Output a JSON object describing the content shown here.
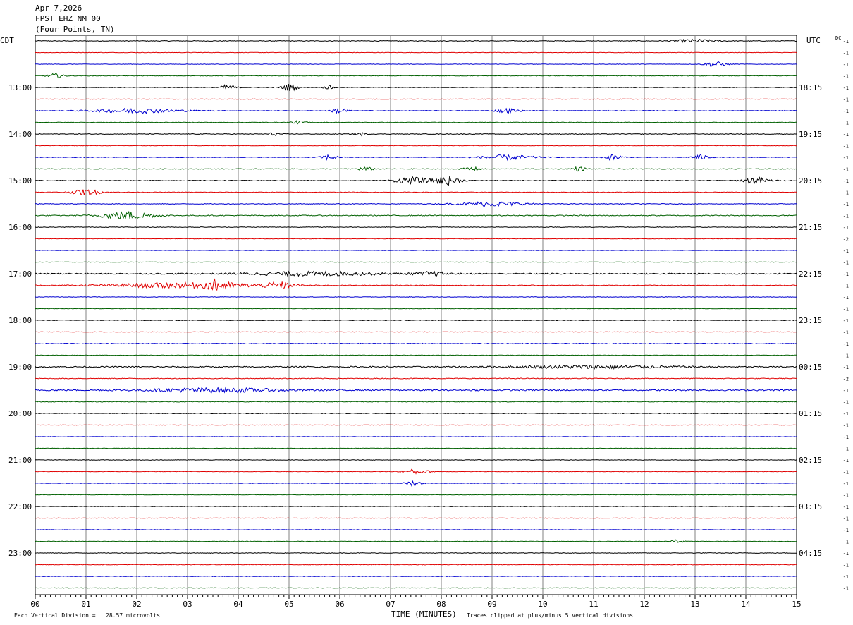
{
  "header": {
    "date": "Apr 7,2026",
    "station": "FPST EHZ NM 00",
    "location": "(Four Points, TN)"
  },
  "labels": {
    "left_tz": "CDT",
    "right_tz": "UTC",
    "dc": "DC"
  },
  "footer": {
    "scale": "Each Vertical Division =   28.57 microvolts",
    "xlabel": "TIME (MINUTES)",
    "clip": "Traces clipped at plus/minus 5 vertical divisions"
  },
  "colors": {
    "cycle": [
      "#000000",
      "#e00000",
      "#0000d0",
      "#006000"
    ],
    "grid": "#808080"
  },
  "chart_data": {
    "type": "line",
    "title": "FPST EHZ NM 00 (Four Points, TN) Apr 7,2026",
    "xlabel": "TIME (MINUTES)",
    "xlim": [
      0,
      15
    ],
    "x_ticks": [
      "00",
      "01",
      "02",
      "03",
      "04",
      "05",
      "06",
      "07",
      "08",
      "09",
      "10",
      "11",
      "12",
      "13",
      "14",
      "15"
    ],
    "rows": 48,
    "row_minutes": 15,
    "left_time_labels": [
      {
        "row": 4,
        "label": "13:00"
      },
      {
        "row": 8,
        "label": "14:00"
      },
      {
        "row": 12,
        "label": "15:00"
      },
      {
        "row": 16,
        "label": "16:00"
      },
      {
        "row": 20,
        "label": "17:00"
      },
      {
        "row": 24,
        "label": "18:00"
      },
      {
        "row": 28,
        "label": "19:00"
      },
      {
        "row": 32,
        "label": "20:00"
      },
      {
        "row": 36,
        "label": "21:00"
      },
      {
        "row": 40,
        "label": "22:00"
      },
      {
        "row": 44,
        "label": "23:00"
      }
    ],
    "right_time_labels": [
      {
        "row": 4,
        "label": "18:15"
      },
      {
        "row": 8,
        "label": "19:15"
      },
      {
        "row": 12,
        "label": "20:15"
      },
      {
        "row": 16,
        "label": "21:15"
      },
      {
        "row": 20,
        "label": "22:15"
      },
      {
        "row": 24,
        "label": "23:15"
      },
      {
        "row": 28,
        "label": "00:15"
      },
      {
        "row": 32,
        "label": "01:15"
      },
      {
        "row": 36,
        "label": "02:15"
      },
      {
        "row": 40,
        "label": "03:15"
      },
      {
        "row": 44,
        "label": "04:15"
      }
    ],
    "dc_offsets": [
      "-1",
      "-1",
      "-1",
      "-1",
      "-1",
      "-1",
      "-1",
      "-1",
      "-1",
      "-1",
      "-1",
      "-1",
      "-1",
      "-1",
      "-1",
      "-1",
      "-1",
      "-2",
      "-1",
      "-1",
      "-1",
      "-1",
      "-1",
      "-1",
      "-1",
      "-1",
      "-1",
      "-1",
      "-1",
      "-2",
      "-1",
      "-1",
      "-1",
      "-1",
      "-1",
      "-1",
      "-1",
      "-1",
      "-1",
      "-1",
      "-1",
      "-1",
      "-1",
      "-1",
      "-1",
      "-1",
      "-1",
      "-1"
    ],
    "row_noise": [
      0.9,
      0.6,
      0.6,
      0.8,
      0.8,
      0.6,
      0.9,
      0.7,
      0.9,
      0.6,
      0.9,
      0.9,
      1.0,
      0.8,
      0.9,
      1.2,
      0.8,
      0.6,
      0.6,
      0.6,
      1.6,
      0.9,
      0.7,
      0.6,
      0.9,
      0.6,
      1.0,
      0.6,
      1.5,
      1.0,
      1.8,
      0.9,
      0.9,
      0.6,
      0.6,
      0.6,
      0.7,
      0.6,
      0.6,
      0.6,
      0.7,
      0.6,
      0.7,
      0.7,
      0.8,
      0.8,
      0.8,
      0.7
    ],
    "events": [
      {
        "row": 0,
        "t": 13.0,
        "amp": 4,
        "dur": 0.8
      },
      {
        "row": 2,
        "t": 13.4,
        "amp": 7,
        "dur": 0.4
      },
      {
        "row": 3,
        "t": 0.4,
        "amp": 6,
        "dur": 0.3
      },
      {
        "row": 4,
        "t": 3.8,
        "amp": 7,
        "dur": 0.3
      },
      {
        "row": 4,
        "t": 5.0,
        "amp": 9,
        "dur": 0.3
      },
      {
        "row": 4,
        "t": 5.8,
        "amp": 5,
        "dur": 0.2
      },
      {
        "row": 6,
        "t": 2.0,
        "amp": 6,
        "dur": 1.6
      },
      {
        "row": 6,
        "t": 6.0,
        "amp": 7,
        "dur": 0.3
      },
      {
        "row": 6,
        "t": 9.3,
        "amp": 6,
        "dur": 0.4
      },
      {
        "row": 7,
        "t": 5.2,
        "amp": 4,
        "dur": 0.3
      },
      {
        "row": 8,
        "t": 4.7,
        "amp": 4,
        "dur": 0.2
      },
      {
        "row": 8,
        "t": 6.4,
        "amp": 4,
        "dur": 0.2
      },
      {
        "row": 10,
        "t": 5.8,
        "amp": 7,
        "dur": 0.3
      },
      {
        "row": 10,
        "t": 9.3,
        "amp": 6,
        "dur": 1.0
      },
      {
        "row": 10,
        "t": 11.4,
        "amp": 8,
        "dur": 0.3
      },
      {
        "row": 10,
        "t": 13.1,
        "amp": 7,
        "dur": 0.3
      },
      {
        "row": 11,
        "t": 6.5,
        "amp": 5,
        "dur": 0.3
      },
      {
        "row": 11,
        "t": 8.6,
        "amp": 5,
        "dur": 0.3
      },
      {
        "row": 11,
        "t": 10.7,
        "amp": 5,
        "dur": 0.3
      },
      {
        "row": 12,
        "t": 7.4,
        "amp": 9,
        "dur": 0.6
      },
      {
        "row": 12,
        "t": 8.1,
        "amp": 12,
        "dur": 0.5
      },
      {
        "row": 12,
        "t": 14.2,
        "amp": 8,
        "dur": 0.5
      },
      {
        "row": 13,
        "t": 1.0,
        "amp": 7,
        "dur": 0.6
      },
      {
        "row": 14,
        "t": 9.0,
        "amp": 6,
        "dur": 1.2
      },
      {
        "row": 15,
        "t": 1.8,
        "amp": 10,
        "dur": 1.0
      },
      {
        "row": 20,
        "t": 5.5,
        "amp": 5,
        "dur": 2.5
      },
      {
        "row": 20,
        "t": 7.8,
        "amp": 5,
        "dur": 0.6
      },
      {
        "row": 21,
        "t": 3.0,
        "amp": 7,
        "dur": 3.0
      },
      {
        "row": 21,
        "t": 3.6,
        "amp": 9,
        "dur": 0.4
      },
      {
        "row": 21,
        "t": 4.8,
        "amp": 8,
        "dur": 0.5
      },
      {
        "row": 28,
        "t": 11.0,
        "amp": 4,
        "dur": 3.0
      },
      {
        "row": 30,
        "t": 3.6,
        "amp": 5,
        "dur": 2.5
      },
      {
        "row": 37,
        "t": 7.5,
        "amp": 6,
        "dur": 0.5
      },
      {
        "row": 38,
        "t": 7.45,
        "amp": 7,
        "dur": 0.3
      },
      {
        "row": 43,
        "t": 12.65,
        "amp": 8,
        "dur": 0.2
      }
    ]
  }
}
